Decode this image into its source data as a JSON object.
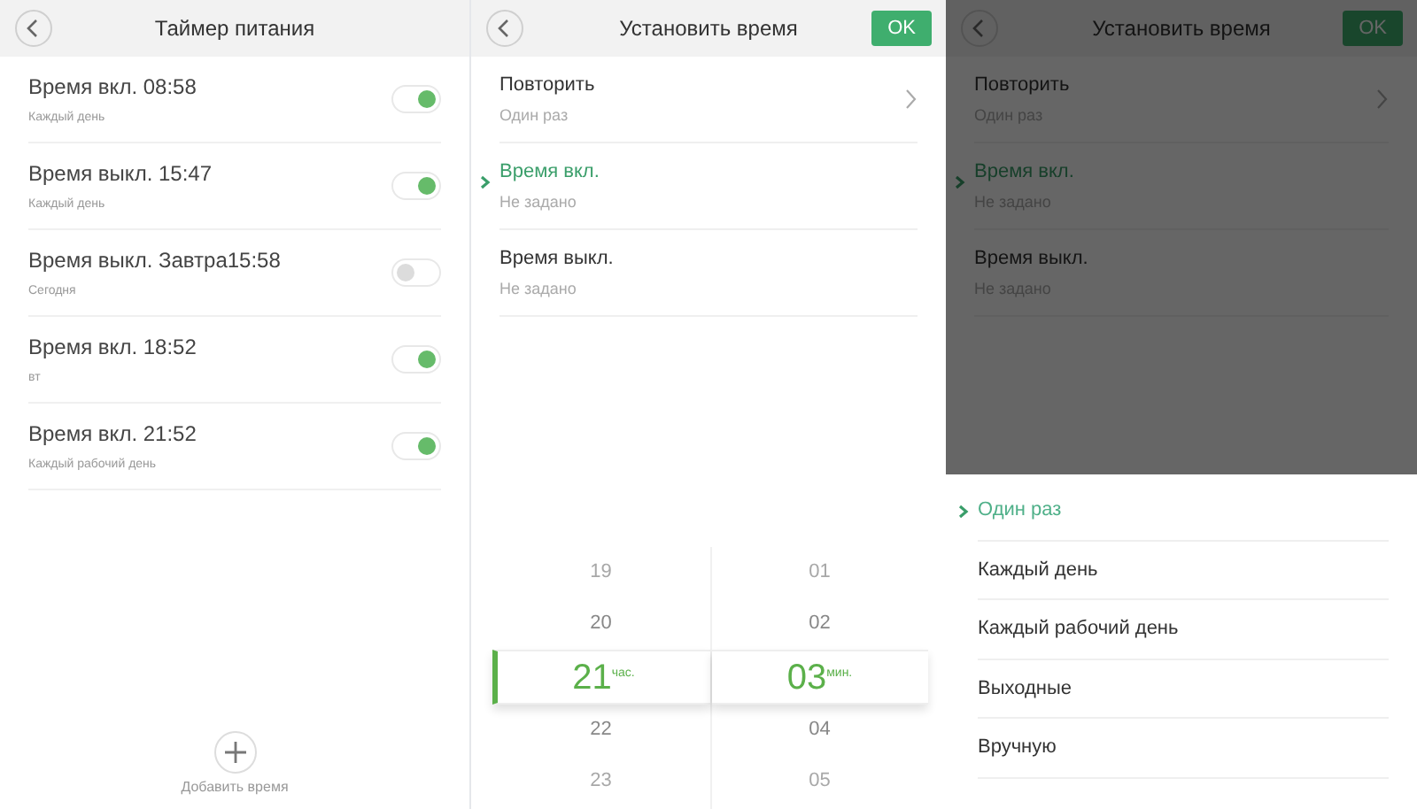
{
  "timer_screen": {
    "title": "Таймер питания",
    "items": [
      {
        "title": "Время вкл. 08:58",
        "subtitle": "Каждый день",
        "on": true
      },
      {
        "title": "Время выкл. 15:47",
        "subtitle": "Каждый день",
        "on": true
      },
      {
        "title": "Время выкл. Завтра15:58",
        "subtitle": "Сегодня",
        "on": false
      },
      {
        "title": "Время вкл. 18:52",
        "subtitle": "вт",
        "on": true
      },
      {
        "title": "Время вкл. 21:52",
        "subtitle": "Каждый рабочий день",
        "on": true
      }
    ],
    "add_label": "Добавить время"
  },
  "set_time_screen": {
    "title": "Установить время",
    "ok": "OK",
    "rows": [
      {
        "label": "Повторить",
        "value": "Один раз",
        "kind": "link",
        "selected": false
      },
      {
        "label": "Время вкл.",
        "value": "Не задано",
        "kind": "plain",
        "selected": true
      },
      {
        "label": "Время выкл.",
        "value": "Не задано",
        "kind": "plain",
        "selected": false
      }
    ],
    "picker": [
      {
        "unit": "час.",
        "values": [
          {
            "text": "19",
            "selected": false
          },
          {
            "text": "20",
            "selected": false
          },
          {
            "text": "21",
            "selected": true
          },
          {
            "text": "22",
            "selected": false
          },
          {
            "text": "23",
            "selected": false
          }
        ]
      },
      {
        "unit": "мин.",
        "values": [
          {
            "text": "01",
            "selected": false
          },
          {
            "text": "02",
            "selected": false
          },
          {
            "text": "03",
            "selected": true
          },
          {
            "text": "04",
            "selected": false
          },
          {
            "text": "05",
            "selected": false
          }
        ]
      }
    ]
  },
  "repeat_screen": {
    "title": "Установить время",
    "ok": "OK",
    "rows": [
      {
        "label": "Повторить",
        "value": "Один раз",
        "kind": "link",
        "selected": false
      },
      {
        "label": "Время вкл.",
        "value": "Не задано",
        "kind": "plain",
        "selected": true
      },
      {
        "label": "Время выкл.",
        "value": "Не задано",
        "kind": "plain",
        "selected": false
      }
    ],
    "options": [
      {
        "label": "Один раз",
        "selected": true
      },
      {
        "label": "Каждый день",
        "selected": false
      },
      {
        "label": "Каждый рабочий день",
        "selected": false
      },
      {
        "label": "Выходные",
        "selected": false
      },
      {
        "label": "Вручную",
        "selected": false
      }
    ]
  }
}
